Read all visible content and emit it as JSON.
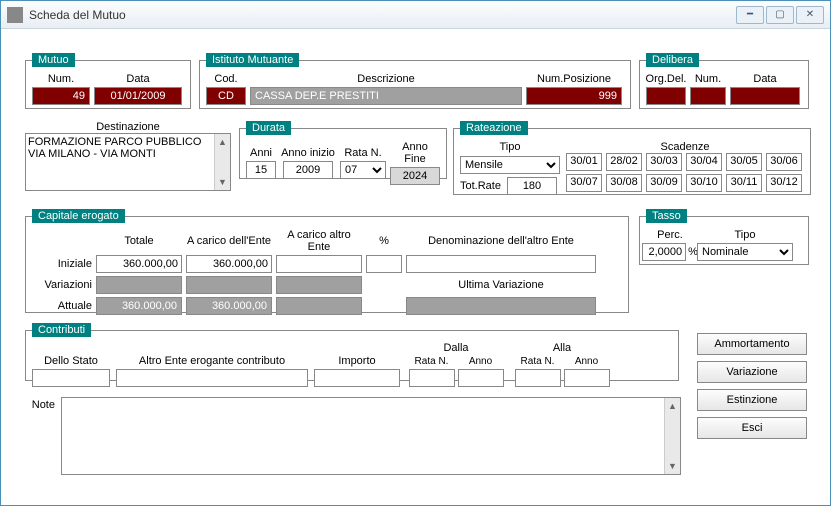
{
  "window": {
    "title": "Scheda del Mutuo"
  },
  "mutuo": {
    "legend": "Mutuo",
    "num_label": "Num.",
    "num": "49",
    "data_label": "Data",
    "data": "01/01/2009"
  },
  "istituto": {
    "legend": "Istituto Mutuante",
    "cod_label": "Cod.",
    "cod": "CD",
    "descr_label": "Descrizione",
    "descr": "CASSA DEP.E PRESTITI",
    "numpos_label": "Num.Posizione",
    "numpos": "999"
  },
  "delibera": {
    "legend": "Delibera",
    "org_label": "Org.Del.",
    "num_label": "Num.",
    "data_label": "Data",
    "org": "",
    "num": "",
    "data": ""
  },
  "destinazione": {
    "label": "Destinazione",
    "text": "FORMAZIONE PARCO PUBBLICO VIA MILANO - VIA MONTI"
  },
  "durata": {
    "legend": "Durata",
    "anni_label": "Anni",
    "anni": "15",
    "annoinizio_label": "Anno inizio",
    "annoinizio": "2009",
    "ratan_label": "Rata N.",
    "ratan": "07",
    "annofine_label": "Anno Fine",
    "annofine": "2024"
  },
  "rateazione": {
    "legend": "Rateazione",
    "tipo_label": "Tipo",
    "tipo": "Mensile",
    "scadenze_label": "Scadenze",
    "totrate_label": "Tot.Rate",
    "totrate": "180",
    "scadenze": [
      "30/01",
      "28/02",
      "30/03",
      "30/04",
      "30/05",
      "30/06",
      "30/07",
      "30/08",
      "30/09",
      "30/10",
      "30/11",
      "30/12"
    ]
  },
  "capitale": {
    "legend": "Capitale erogato",
    "iniziale_label": "Iniziale",
    "variazioni_label": "Variazioni",
    "attuale_label": "Attuale",
    "totale_label": "Totale",
    "acar_ente_label": "A carico dell'Ente",
    "acar_altro_label": "A carico altro Ente",
    "pct_label": "%",
    "denom_label": "Denominazione dell'altro Ente",
    "ultima_var_label": "Ultima Variazione",
    "iniziale_tot": "360.000,00",
    "iniziale_ente": "360.000,00",
    "iniziale_altro": "",
    "iniziale_pct": "",
    "iniziale_denom": "",
    "attuale_tot": "360.000,00",
    "attuale_ente": "360.000,00"
  },
  "tasso": {
    "legend": "Tasso",
    "perc_label": "Perc.",
    "perc": "2,0000",
    "pct_sign": "%",
    "tipo_label": "Tipo",
    "tipo": "Nominale"
  },
  "contributi": {
    "legend": "Contributi",
    "stato_label": "Dello Stato",
    "altroente_label": "Altro Ente erogante contributo",
    "importo_label": "Importo",
    "dalla_label": "Dalla",
    "alla_label": "Alla",
    "ratan_label": "Rata N.",
    "anno_label": "Anno"
  },
  "note_label": "Note",
  "buttons": {
    "ammortamento": "Ammortamento",
    "variazione": "Variazione",
    "estinzione": "Estinzione",
    "esci": "Esci"
  }
}
